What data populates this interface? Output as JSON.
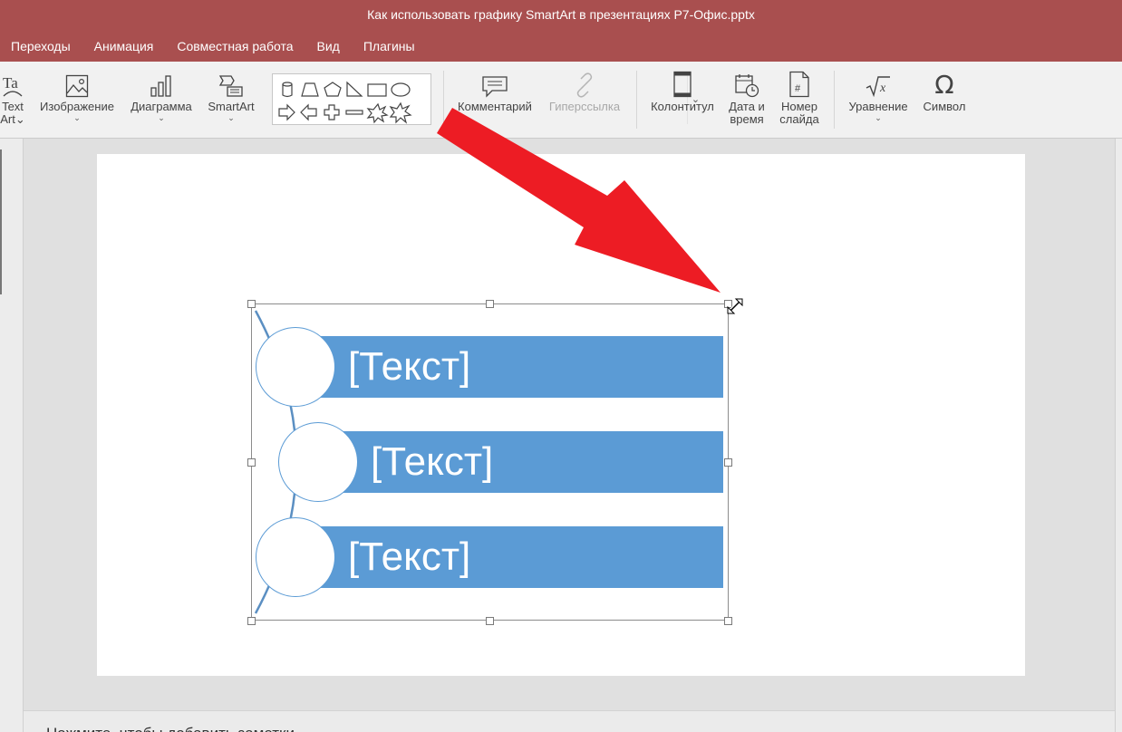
{
  "window": {
    "title": "Как использовать графику SmartArt в презентациях Р7-Офис.pptx"
  },
  "tabs": [
    "Переходы",
    "Анимация",
    "Совместная работа",
    "Вид",
    "Плагины"
  ],
  "ribbon": {
    "textart": {
      "line1": "Text",
      "line2": "Art"
    },
    "image": "Изображение",
    "chart": "Диаграмма",
    "smartart": "SmartArt",
    "comment": "Комментарий",
    "hyperlink": "Гиперссылка",
    "header_footer": "Колонтитул",
    "datetime": {
      "line1": "Дата и",
      "line2": "время"
    },
    "slide_number": {
      "line1": "Номер",
      "line2": "слайда"
    },
    "equation": "Уравнение",
    "symbol": "Символ"
  },
  "smartart": {
    "items": [
      "[Текст]",
      "[Текст]",
      "[Текст]"
    ]
  },
  "notes": {
    "placeholder": "Нажмите, чтобы добавить заметки"
  },
  "colors": {
    "topbar": "#a94f4f",
    "bar": "#5b9bd5",
    "arrow": "#ed1c24"
  }
}
